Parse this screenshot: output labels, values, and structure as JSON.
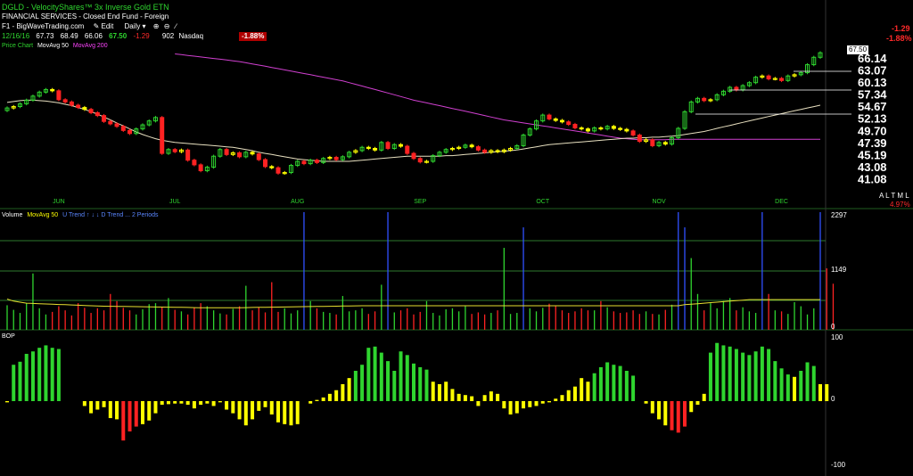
{
  "header": {
    "title": "DGLD - VelocityShares™ 3x Inverse Gold ETN",
    "subtitle": "FINANCIAL SERVICES - Closed End Fund - Foreign",
    "toolbar": {
      "source": "F1 - BigWaveTrading.com",
      "edit": "Edit",
      "period": "Daily",
      "period_arrow": "▾",
      "zoom_in": "⊕",
      "zoom_out": "⊖",
      "draw": "∕"
    },
    "quote": {
      "date": "12/16/16",
      "open": "67.73",
      "high": "68.49",
      "low": "66.06",
      "close": "67.50",
      "change": "-1.29",
      "volume": "902",
      "exchange": "Nasdaq",
      "pct_badge": "-1.88%"
    },
    "right_change": "-1.29",
    "right_pct": "-1.88%"
  },
  "panels": {
    "price": {
      "label": "Price Chart",
      "ma50": "MovAvg 50",
      "ma200": "MovAvg 200",
      "last_price": "67.50",
      "alm": "A L T M L",
      "alm_pct": "4.97%"
    },
    "volume": {
      "label": "Volume",
      "ma": "MovAvg 50",
      "legend_extra": "U Trend ↑ ↓ ↓ D Trend ... 2 Periods",
      "max_tick": "2297",
      "mid_tick": "1149",
      "zero_tick": "0"
    },
    "bop": {
      "label": "BOP",
      "top_tick": "100",
      "mid_tick": "0",
      "bottom_tick": "-100"
    }
  },
  "colors": {
    "up": "#2fd52f",
    "down": "#ff2222",
    "neutral": "#ffff00",
    "ma50": "#e8e0c0",
    "ma200": "#d040d0",
    "volume_ma": "#e8e030",
    "volume_spike": "#3050ff",
    "grid": "#2e7a2e"
  },
  "chart_data": [
    {
      "type": "candlestick",
      "title": "DGLD - VelocityShares™ 3x Inverse Gold ETN",
      "y_ticks": [
        41.08,
        43.08,
        45.19,
        47.39,
        49.7,
        52.13,
        54.67,
        57.34,
        60.13,
        63.07,
        66.14
      ],
      "ylim": [
        40.3,
        68.5
      ],
      "x_month_labels": [
        {
          "label": "JUN",
          "index": 8
        },
        {
          "label": "JUL",
          "index": 26
        },
        {
          "label": "AUG",
          "index": 45
        },
        {
          "label": "SEP",
          "index": 64
        },
        {
          "label": "OCT",
          "index": 83
        },
        {
          "label": "NOV",
          "index": 101
        },
        {
          "label": "DEC",
          "index": 120
        }
      ],
      "scale": "log",
      "close": [
        54.3,
        54.6,
        55.2,
        56.0,
        56.9,
        57.8,
        58.4,
        58.1,
        56.1,
        55.6,
        54.9,
        54.4,
        54.0,
        53.3,
        52.7,
        51.5,
        51.0,
        50.5,
        49.7,
        49.1,
        50.0,
        50.8,
        51.6,
        52.3,
        45.4,
        46.1,
        45.7,
        46.0,
        44.2,
        43.4,
        42.4,
        43.0,
        44.9,
        46.1,
        45.2,
        45.5,
        44.8,
        45.6,
        45.3,
        44.3,
        43.1,
        42.9,
        42.0,
        42.1,
        43.3,
        44.0,
        43.6,
        44.2,
        43.8,
        44.5,
        44.7,
        44.3,
        44.8,
        45.6,
        45.9,
        46.5,
        46.3,
        46.0,
        47.4,
        46.3,
        47.0,
        46.7,
        45.4,
        44.5,
        43.9,
        44.0,
        45.0,
        45.6,
        46.1,
        46.3,
        46.5,
        46.9,
        46.6,
        46.0,
        45.6,
        45.9,
        45.7,
        46.0,
        46.3,
        46.8,
        48.8,
        50.0,
        51.6,
        52.8,
        52.0,
        51.7,
        51.4,
        50.9,
        50.2,
        50.0,
        49.6,
        50.2,
        50.0,
        50.5,
        50.1,
        49.9,
        49.6,
        48.8,
        47.6,
        47.9,
        46.8,
        47.4,
        47.1,
        48.3,
        50.1,
        53.5,
        55.6,
        56.4,
        55.9,
        56.1,
        57.2,
        58.0,
        58.9,
        58.3,
        59.3,
        60.0,
        61.3,
        61.6,
        60.9,
        61.0,
        60.5,
        61.6,
        61.9,
        62.4,
        64.4,
        66.3,
        67.5
      ],
      "ma50": [
        55.5,
        55.7,
        55.9,
        56.0,
        56.0,
        55.9,
        55.8,
        55.6,
        55.4,
        55.1,
        54.8,
        54.4,
        54.0,
        53.5,
        53.0,
        52.4,
        51.8,
        51.2,
        50.6,
        50.0,
        49.4,
        48.9,
        48.5,
        48.1,
        47.8,
        47.6,
        47.4,
        47.3,
        47.2,
        47.1,
        47.0,
        46.9,
        46.8,
        46.7,
        46.6,
        46.5,
        46.3,
        46.1,
        45.9,
        45.6,
        45.4,
        45.2,
        45.0,
        44.8,
        44.6,
        44.4,
        44.3,
        44.2,
        44.1,
        44.0,
        44.0,
        44.0,
        44.0,
        44.0,
        44.1,
        44.2,
        44.3,
        44.4,
        44.5,
        44.6,
        44.7,
        44.8,
        44.9,
        44.9,
        44.9,
        44.9,
        44.9,
        44.9,
        45.0,
        45.0,
        45.1,
        45.2,
        45.3,
        45.4,
        45.5,
        45.6,
        45.7,
        45.8,
        45.9,
        46.0,
        46.2,
        46.4,
        46.6,
        46.8,
        47.0,
        47.1,
        47.2,
        47.3,
        47.4,
        47.5,
        47.6,
        47.7,
        47.8,
        47.9,
        48.0,
        48.1,
        48.2,
        48.2,
        48.3,
        48.3,
        48.4,
        48.4,
        48.5,
        48.6,
        48.7,
        48.9,
        49.1,
        49.3,
        49.5,
        49.8,
        50.1,
        50.4,
        50.7,
        51.0,
        51.3,
        51.6,
        51.9,
        52.2,
        52.5,
        52.8,
        53.1,
        53.4,
        53.7,
        54.0,
        54.3,
        54.6,
        54.9
      ],
      "ma200": [
        null,
        null,
        null,
        null,
        null,
        null,
        null,
        null,
        null,
        null,
        null,
        null,
        null,
        null,
        null,
        null,
        null,
        null,
        null,
        null,
        null,
        null,
        null,
        null,
        null,
        null,
        67.2,
        67.0,
        66.8,
        66.6,
        66.4,
        66.2,
        66.0,
        65.8,
        65.6,
        65.4,
        65.2,
        64.9,
        64.6,
        64.3,
        64.0,
        63.7,
        63.4,
        63.1,
        62.8,
        62.5,
        62.2,
        61.9,
        61.6,
        61.3,
        61.0,
        60.7,
        60.4,
        60.0,
        59.6,
        59.2,
        58.8,
        58.4,
        58.0,
        57.6,
        57.2,
        56.8,
        56.4,
        56.0,
        55.7,
        55.4,
        55.1,
        54.8,
        54.5,
        54.2,
        53.9,
        53.6,
        53.3,
        53.0,
        52.7,
        52.4,
        52.1,
        51.8,
        51.6,
        51.4,
        51.2,
        51.0,
        50.8,
        50.6,
        50.4,
        50.2,
        50.0,
        49.8,
        49.6,
        49.4,
        49.2,
        49.0,
        48.8,
        48.6,
        48.4,
        48.2,
        48.1,
        48.0,
        47.9,
        47.9,
        47.9,
        47.9,
        47.9,
        48.0,
        48.0,
        48.0,
        48.0,
        48.0,
        48.0,
        48.0,
        48.0,
        48.0,
        48.0,
        48.0,
        48.0,
        48.0,
        48.0,
        48.0,
        48.0,
        48.0,
        48.0,
        48.0,
        48.0,
        48.0,
        48.0,
        48.0,
        48.0
      ]
    },
    {
      "type": "bar",
      "title": "Volume",
      "ylim": [
        0,
        2297
      ],
      "y_ticks": [
        0,
        1149,
        2297
      ],
      "values": [
        480,
        390,
        330,
        520,
        1100,
        420,
        300,
        350,
        460,
        380,
        280,
        520,
        430,
        330,
        420,
        380,
        700,
        560,
        430,
        380,
        300,
        400,
        500,
        520,
        440,
        620,
        390,
        360,
        300,
        430,
        520,
        460,
        380,
        320,
        300,
        410,
        460,
        860,
        380,
        440,
        340,
        930,
        350,
        420,
        320,
        380,
        2297,
        560,
        420,
        350,
        330,
        300,
        660,
        360,
        380,
        420,
        310,
        360,
        880,
        2297,
        340,
        380,
        420,
        300,
        350,
        560,
        330,
        280,
        400,
        420,
        360,
        460,
        310,
        340,
        300,
        330,
        380,
        1600,
        310,
        330,
        2000,
        420,
        360,
        430,
        510,
        460,
        380,
        330,
        360,
        420,
        380,
        380,
        560,
        440,
        360,
        330,
        340,
        380,
        310,
        360,
        310,
        300,
        390,
        490,
        2297,
        2000,
        1400,
        700,
        380,
        520,
        420,
        560,
        620,
        380,
        440,
        360,
        330,
        2297,
        700,
        380,
        360,
        310,
        540,
        460,
        300,
        420,
        2297,
        1200,
        900
      ],
      "ma50": [
        600,
        560,
        540,
        520,
        515,
        510,
        505,
        500,
        495,
        490,
        485,
        480,
        475,
        470,
        465,
        462,
        460,
        458,
        456,
        454,
        452,
        450,
        448,
        446,
        444,
        442,
        440,
        438,
        436,
        434,
        432,
        430,
        430,
        430,
        430,
        430,
        432,
        434,
        436,
        438,
        440,
        442,
        444,
        446,
        448,
        450,
        452,
        454,
        456,
        458,
        460,
        462,
        464,
        466,
        468,
        470,
        470,
        470,
        470,
        470,
        470,
        470,
        470,
        470,
        470,
        470,
        470,
        470,
        470,
        470,
        470,
        470,
        470,
        470,
        470,
        470,
        470,
        470,
        470,
        470,
        470,
        470,
        470,
        470,
        470,
        470,
        470,
        470,
        470,
        470,
        470,
        470,
        470,
        470,
        470,
        470,
        470,
        470,
        470,
        470,
        470,
        470,
        470,
        470,
        470,
        490,
        500,
        510,
        520,
        530,
        540,
        550,
        560,
        570,
        580,
        590,
        590,
        590,
        590,
        590,
        590,
        590,
        590,
        590,
        590,
        590,
        590
      ]
    },
    {
      "type": "bar",
      "title": "BOP",
      "ylim": [
        -100,
        100
      ],
      "y_ticks": [
        100,
        0,
        -100
      ],
      "values": [
        -2,
        60,
        65,
        78,
        82,
        88,
        92,
        88,
        86,
        0,
        0,
        0,
        -8,
        -20,
        -14,
        -10,
        -28,
        -30,
        -65,
        -50,
        -42,
        -38,
        -32,
        -20,
        -6,
        -5,
        -4,
        -4,
        -6,
        -12,
        -6,
        -4,
        -8,
        -2,
        -14,
        -20,
        -30,
        -40,
        -30,
        -16,
        -10,
        -22,
        -35,
        -38,
        -40,
        -38,
        0,
        -4,
        2,
        6,
        12,
        18,
        28,
        38,
        50,
        60,
        88,
        90,
        80,
        66,
        50,
        82,
        76,
        62,
        56,
        52,
        32,
        28,
        32,
        20,
        12,
        10,
        8,
        -8,
        10,
        16,
        12,
        -12,
        -22,
        -20,
        -12,
        -10,
        -8,
        -4,
        -2,
        4,
        10,
        18,
        24,
        38,
        32,
        46,
        56,
        64,
        60,
        58,
        50,
        42,
        0,
        -4,
        -20,
        -30,
        -40,
        -48,
        -52,
        -42,
        -18,
        -6,
        12,
        80,
        96,
        92,
        90,
        86,
        80,
        76,
        82,
        90,
        86,
        66,
        54,
        44,
        40,
        50,
        64,
        58,
        28,
        28
      ]
    }
  ]
}
